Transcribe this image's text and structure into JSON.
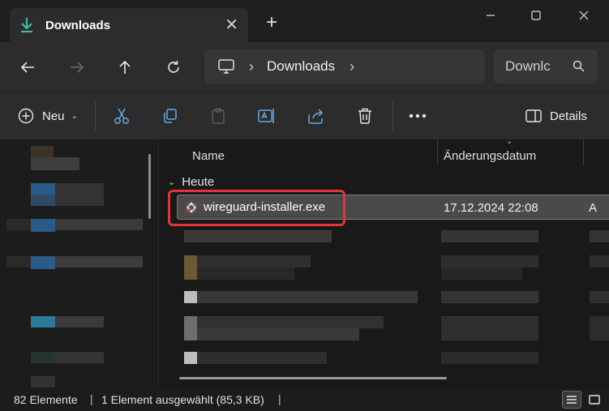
{
  "window": {
    "tab_title": "Downloads",
    "tab_icon": "download-icon",
    "accent": "#3fbf9f"
  },
  "address_bar": {
    "root_icon": "this-pc-icon",
    "crumb": "Downloads"
  },
  "search": {
    "value": "Downlc"
  },
  "toolbar": {
    "new_label": "Neu",
    "details_label": "Details"
  },
  "columns": {
    "name": "Name",
    "modified": "Änderungsdatum"
  },
  "group": {
    "label": "Heute"
  },
  "selected_file": {
    "name": "wireguard-installer.exe",
    "modified": "17.12.2024 22:08",
    "type_prefix": "A",
    "highlight_color": "#e0343a"
  },
  "status": {
    "item_count": "82 Elemente",
    "selection": "1 Element ausgewählt (85,3 KB)"
  }
}
